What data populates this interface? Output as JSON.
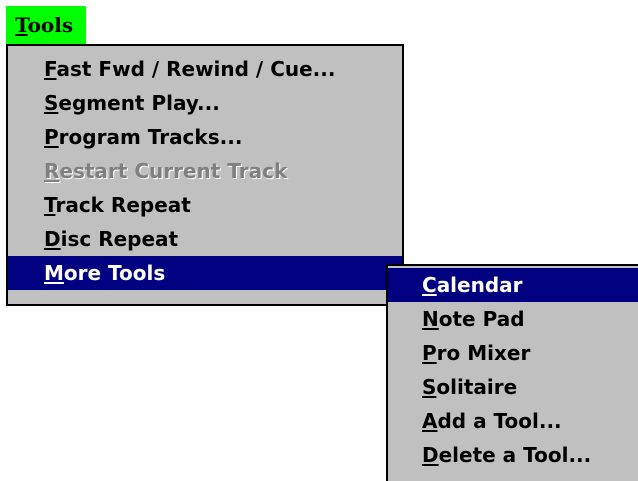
{
  "menubar": {
    "tools": {
      "accel": "T",
      "rest": "ools"
    }
  },
  "tools_menu": {
    "items": [
      {
        "accel": "F",
        "rest": "ast Fwd / Rewind / Cue...",
        "state": "normal"
      },
      {
        "accel": "S",
        "rest": "egment Play...",
        "state": "normal"
      },
      {
        "accel": "P",
        "rest": "rogram Tracks...",
        "state": "normal"
      },
      {
        "accel": "R",
        "rest": "estart Current Track",
        "state": "disabled"
      },
      {
        "accel": "T",
        "rest": "rack Repeat",
        "state": "normal"
      },
      {
        "accel": "D",
        "rest": "isc Repeat",
        "state": "normal"
      },
      {
        "accel": "M",
        "rest": "ore Tools",
        "state": "highlighted"
      }
    ]
  },
  "more_tools_menu": {
    "items": [
      {
        "accel": "C",
        "rest": "alendar",
        "state": "highlighted"
      },
      {
        "accel": "N",
        "rest": "ote Pad",
        "state": "normal"
      },
      {
        "accel": "P",
        "rest": "ro Mixer",
        "state": "normal"
      },
      {
        "accel": "S",
        "rest": "olitaire",
        "state": "normal"
      },
      {
        "accel": "A",
        "rest": "dd a Tool...",
        "state": "normal"
      },
      {
        "accel": "D",
        "rest": "elete a Tool...",
        "state": "normal"
      }
    ]
  },
  "colors": {
    "menubar_highlight": "#00ff00",
    "menu_background": "#c0c0c0",
    "selection_background": "#000080",
    "selection_text": "#ffffff",
    "disabled_text": "#808080"
  }
}
